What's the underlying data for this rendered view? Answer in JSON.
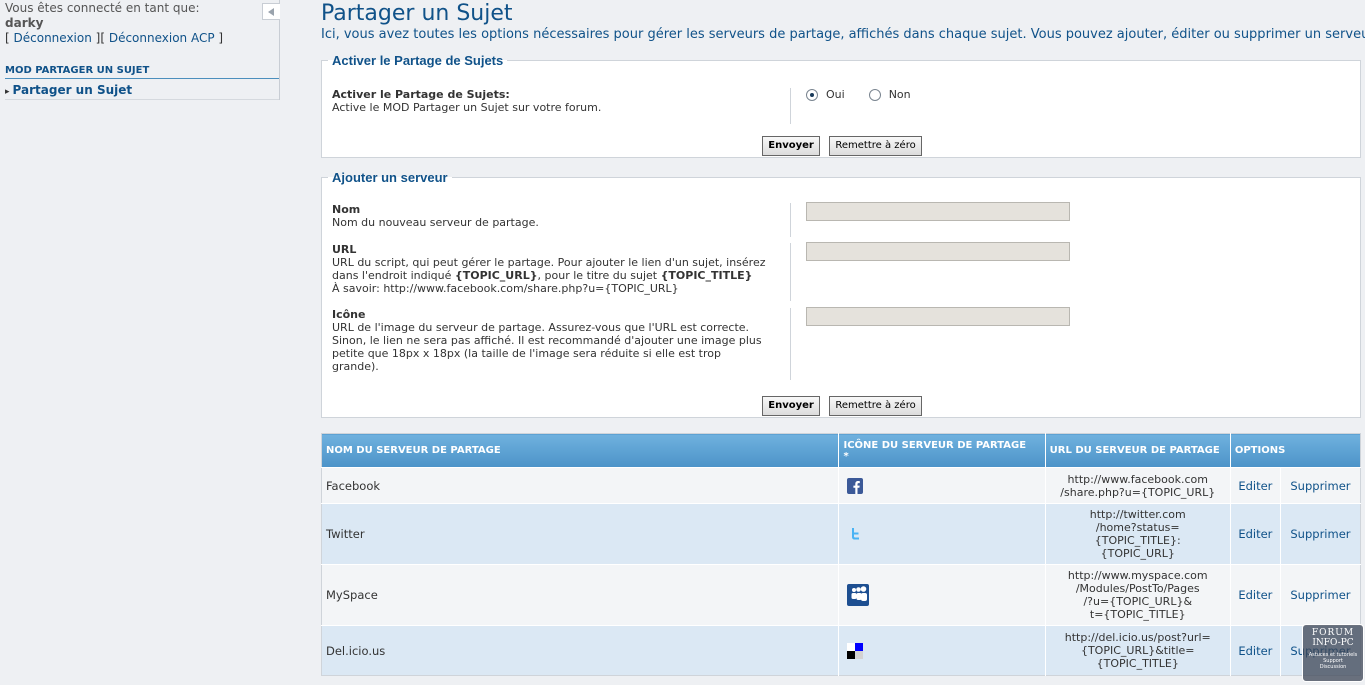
{
  "sidebar": {
    "connected_label": "Vous êtes connecté en tant que:",
    "username": "darky",
    "logout": "Déconnexion",
    "logout_acp": "Déconnexion ACP",
    "section_title": "MOD PARTAGER UN SUJET",
    "active_item": "Partager un Sujet"
  },
  "page": {
    "title": "Partager un Sujet",
    "intro": "Ici, vous avez toutes les options nécessaires pour gérer les serveurs de partage, affichés dans chaque sujet. Vous pouvez ajouter, éditer ou supprimer un serveur."
  },
  "activate": {
    "legend": "Activer le Partage de Sujets",
    "label": "Activer le Partage de Sujets:",
    "desc": "Active le MOD Partager un Sujet sur votre forum.",
    "option_yes": "Oui",
    "option_no": "Non",
    "selected": "Oui",
    "submit": "Envoyer",
    "reset": "Remettre à zéro"
  },
  "add_server": {
    "legend": "Ajouter un serveur",
    "name_label": "Nom",
    "name_desc": "Nom du nouveau serveur de partage.",
    "name_value": "",
    "url_label": "URL",
    "url_desc_1": "URL du script, qui peut gérer le partage. Pour ajouter le lien d'un sujet, insérez",
    "url_desc_2a": "dans l'endroit indiqué ",
    "url_token_1": "{TOPIC_URL}",
    "url_desc_2b": ", pour le titre du sujet ",
    "url_token_2": "{TOPIC_TITLE}",
    "url_desc_3": "À savoir: http://www.facebook.com/share.php?u={TOPIC_URL}",
    "url_value": "",
    "icon_label": "Icône",
    "icon_desc_1": "URL de l'image du serveur de partage. Assurez-vous que l'URL est correcte.",
    "icon_desc_2": "Sinon, le lien ne sera pas affiché. Il est recommandé d'ajouter une image plus",
    "icon_desc_3": "petite que 18px x 18px (la taille de l'image sera réduite si elle est trop",
    "icon_desc_4": "grande).",
    "icon_value": "",
    "submit": "Envoyer",
    "reset": "Remettre à zéro"
  },
  "table": {
    "headers": {
      "name": "NOM DU SERVEUR DE PARTAGE",
      "icon": "ICÔNE DU SERVEUR DE PARTAGE",
      "icon_note": "*",
      "url": "URL DU SERVEUR DE PARTAGE",
      "options": "OPTIONS"
    },
    "rows": [
      {
        "name": "Facebook",
        "icon": "facebook-icon",
        "url": [
          "http://www.facebook.com",
          "/share.php?u={TOPIC_URL}"
        ],
        "edit": "Editer",
        "delete": "Supprimer"
      },
      {
        "name": "Twitter",
        "icon": "twitter-icon",
        "url": [
          "http://twitter.com",
          "/home?status=",
          "{TOPIC_TITLE}:",
          "{TOPIC_URL}"
        ],
        "edit": "Editer",
        "delete": "Supprimer"
      },
      {
        "name": "MySpace",
        "icon": "myspace-icon",
        "url": [
          "http://www.myspace.com",
          "/Modules/PostTo/Pages",
          "/?u={TOPIC_URL}&",
          "t={TOPIC_TITLE}"
        ],
        "edit": "Editer",
        "delete": "Supprimer"
      },
      {
        "name": "Del.icio.us",
        "icon": "delicious-icon",
        "url": [
          "http://del.icio.us/post?url=",
          "{TOPIC_URL}&title=",
          "{TOPIC_TITLE}"
        ],
        "edit": "Editer",
        "delete": "Supprimer"
      }
    ]
  },
  "watermark": {
    "line1": "FORUM",
    "line2": "INFO-PC",
    "line3": "Astuces et tutoriels",
    "line4": "Support",
    "line5": "Discussion"
  },
  "colors": {
    "accent": "#105289",
    "table_header": "#5ba3d6",
    "row_alt": "#dbe8f4"
  }
}
